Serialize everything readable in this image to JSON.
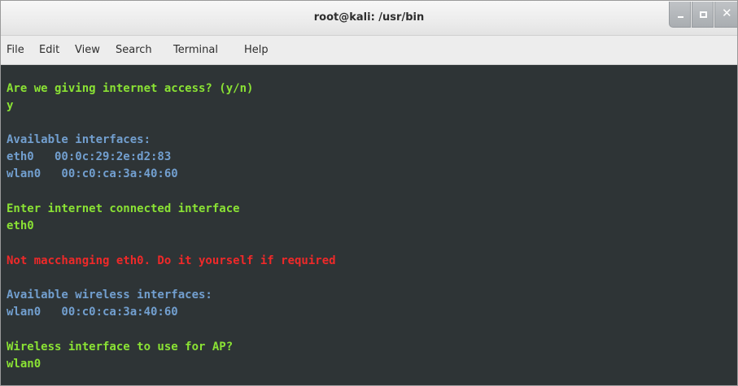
{
  "window": {
    "title": "root@kali: /usr/bin"
  },
  "menubar": {
    "items": [
      "File",
      "Edit",
      "View",
      "Search",
      "Terminal",
      "Help"
    ]
  },
  "terminal": {
    "colors": {
      "background": "#2e3436",
      "green": "#8ae234",
      "blue": "#729fcf",
      "red": "#ef2929"
    },
    "lines": [
      {
        "text": "Are we giving internet access? (y/n)",
        "color": "green"
      },
      {
        "text": "y",
        "color": "green"
      },
      {
        "text": "Available interfaces:",
        "color": "blue"
      },
      {
        "text": "eth0   00:0c:29:2e:d2:83",
        "color": "blue"
      },
      {
        "text": "wlan0   00:c0:ca:3a:40:60",
        "color": "blue"
      },
      {
        "text": "Enter internet connected interface",
        "color": "green"
      },
      {
        "text": "eth0",
        "color": "green"
      },
      {
        "text": "Not macchanging eth0. Do it yourself if required",
        "color": "red"
      },
      {
        "text": "Available wireless interfaces:",
        "color": "blue"
      },
      {
        "text": "wlan0   00:c0:ca:3a:40:60",
        "color": "blue"
      },
      {
        "text": "Wireless interface to use for AP?",
        "color": "green"
      },
      {
        "text": "wlan0",
        "color": "green"
      }
    ]
  }
}
